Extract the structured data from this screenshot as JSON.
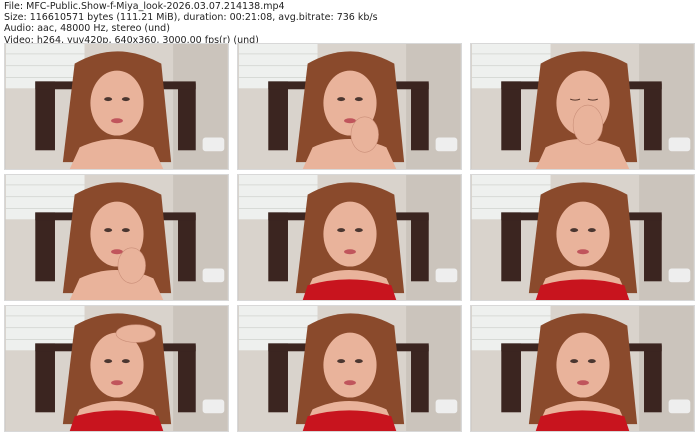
{
  "header": {
    "file": "File: MFC-Public.Show-f-Miya_look-2026.03.07.214138.mp4",
    "size": "Size: 116610571 bytes (111.21 MiB), duration: 00:21:08, avg.bitrate: 736 kb/s",
    "audio": "Audio: aac, 48000 Hz, stereo (und)",
    "video": "Video: h264, yuv420p, 640x360, 3000.00 fps(r) (und)"
  },
  "thumbnails": [
    {
      "label": "frame-1",
      "pose": "lips",
      "dress": false
    },
    {
      "label": "frame-2",
      "pose": "chin-hand",
      "dress": false
    },
    {
      "label": "frame-3",
      "pose": "hand-mouth",
      "dress": false
    },
    {
      "label": "frame-4",
      "pose": "chin-hand",
      "dress": false
    },
    {
      "label": "frame-5",
      "pose": "neutral",
      "dress": true
    },
    {
      "label": "frame-6",
      "pose": "neutral",
      "dress": true
    },
    {
      "label": "frame-7",
      "pose": "head-hand",
      "dress": true
    },
    {
      "label": "frame-8",
      "pose": "neutral",
      "dress": true
    },
    {
      "label": "frame-9",
      "pose": "neutral",
      "dress": true
    }
  ],
  "colors": {
    "wall": "#d9d3cc",
    "window": "#eef0ee",
    "chair": "#3b2520",
    "hair": "#8a4a2c",
    "skin": "#e9b39b",
    "dress": "#c8141e"
  }
}
